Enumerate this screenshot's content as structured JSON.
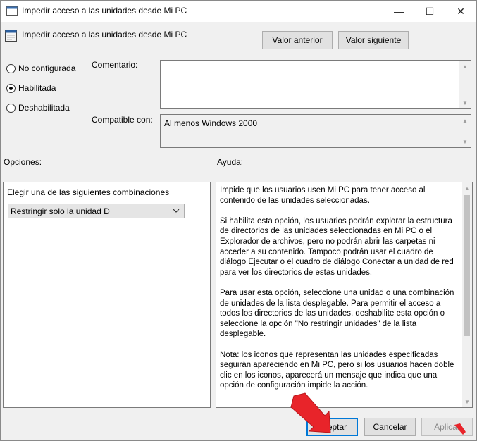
{
  "window": {
    "title": "Impedir acceso a las unidades desde Mi PC",
    "minimize_glyph": "—",
    "maximize_glyph": "☐",
    "close_glyph": "✕"
  },
  "header": {
    "policy_name": "Impedir acceso a las unidades desde Mi PC",
    "prev_label": "Valor anterior",
    "next_label": "Valor siguiente"
  },
  "state": {
    "options": [
      {
        "label": "No configurada",
        "selected": false
      },
      {
        "label": "Habilitada",
        "selected": true
      },
      {
        "label": "Deshabilitada",
        "selected": false
      }
    ]
  },
  "comment": {
    "label": "Comentario:",
    "value": ""
  },
  "supported": {
    "label": "Compatible con:",
    "value": "Al menos Windows 2000"
  },
  "options_panel": {
    "label": "Opciones:",
    "field_label": "Elegir una de las siguientes combinaciones",
    "selected_value": "Restringir solo la unidad D"
  },
  "help_panel": {
    "label": "Ayuda:",
    "paragraphs": [
      "Impide que los usuarios usen Mi PC para tener acceso al contenido de las unidades seleccionadas.",
      "Si habilita esta opción, los usuarios podrán explorar la estructura de directorios de las unidades seleccionadas en Mi PC o el Explorador de archivos, pero no podrán abrir las carpetas ni acceder a su contenido. Tampoco podrán usar el cuadro de diálogo Ejecutar o el cuadro de diálogo Conectar a unidad de red para ver los directorios de estas unidades.",
      "Para usar esta opción, seleccione una unidad o una combinación de unidades de la lista desplegable. Para permitir el acceso a todos los directorios de las unidades, deshabilite esta opción o seleccione la opción \"No restringir unidades\" de la lista desplegable.",
      "Nota: los iconos que representan las unidades especificadas seguirán apareciendo en Mi PC, pero si los usuarios hacen doble clic en los iconos, aparecerá un mensaje que indica que una opción de configuración impide la acción."
    ]
  },
  "footer": {
    "ok_label": "Aceptar",
    "cancel_label": "Cancelar",
    "apply_label": "Aplicar"
  },
  "colors": {
    "accent": "#0078d7",
    "annotation_arrow": "#e8242a"
  }
}
